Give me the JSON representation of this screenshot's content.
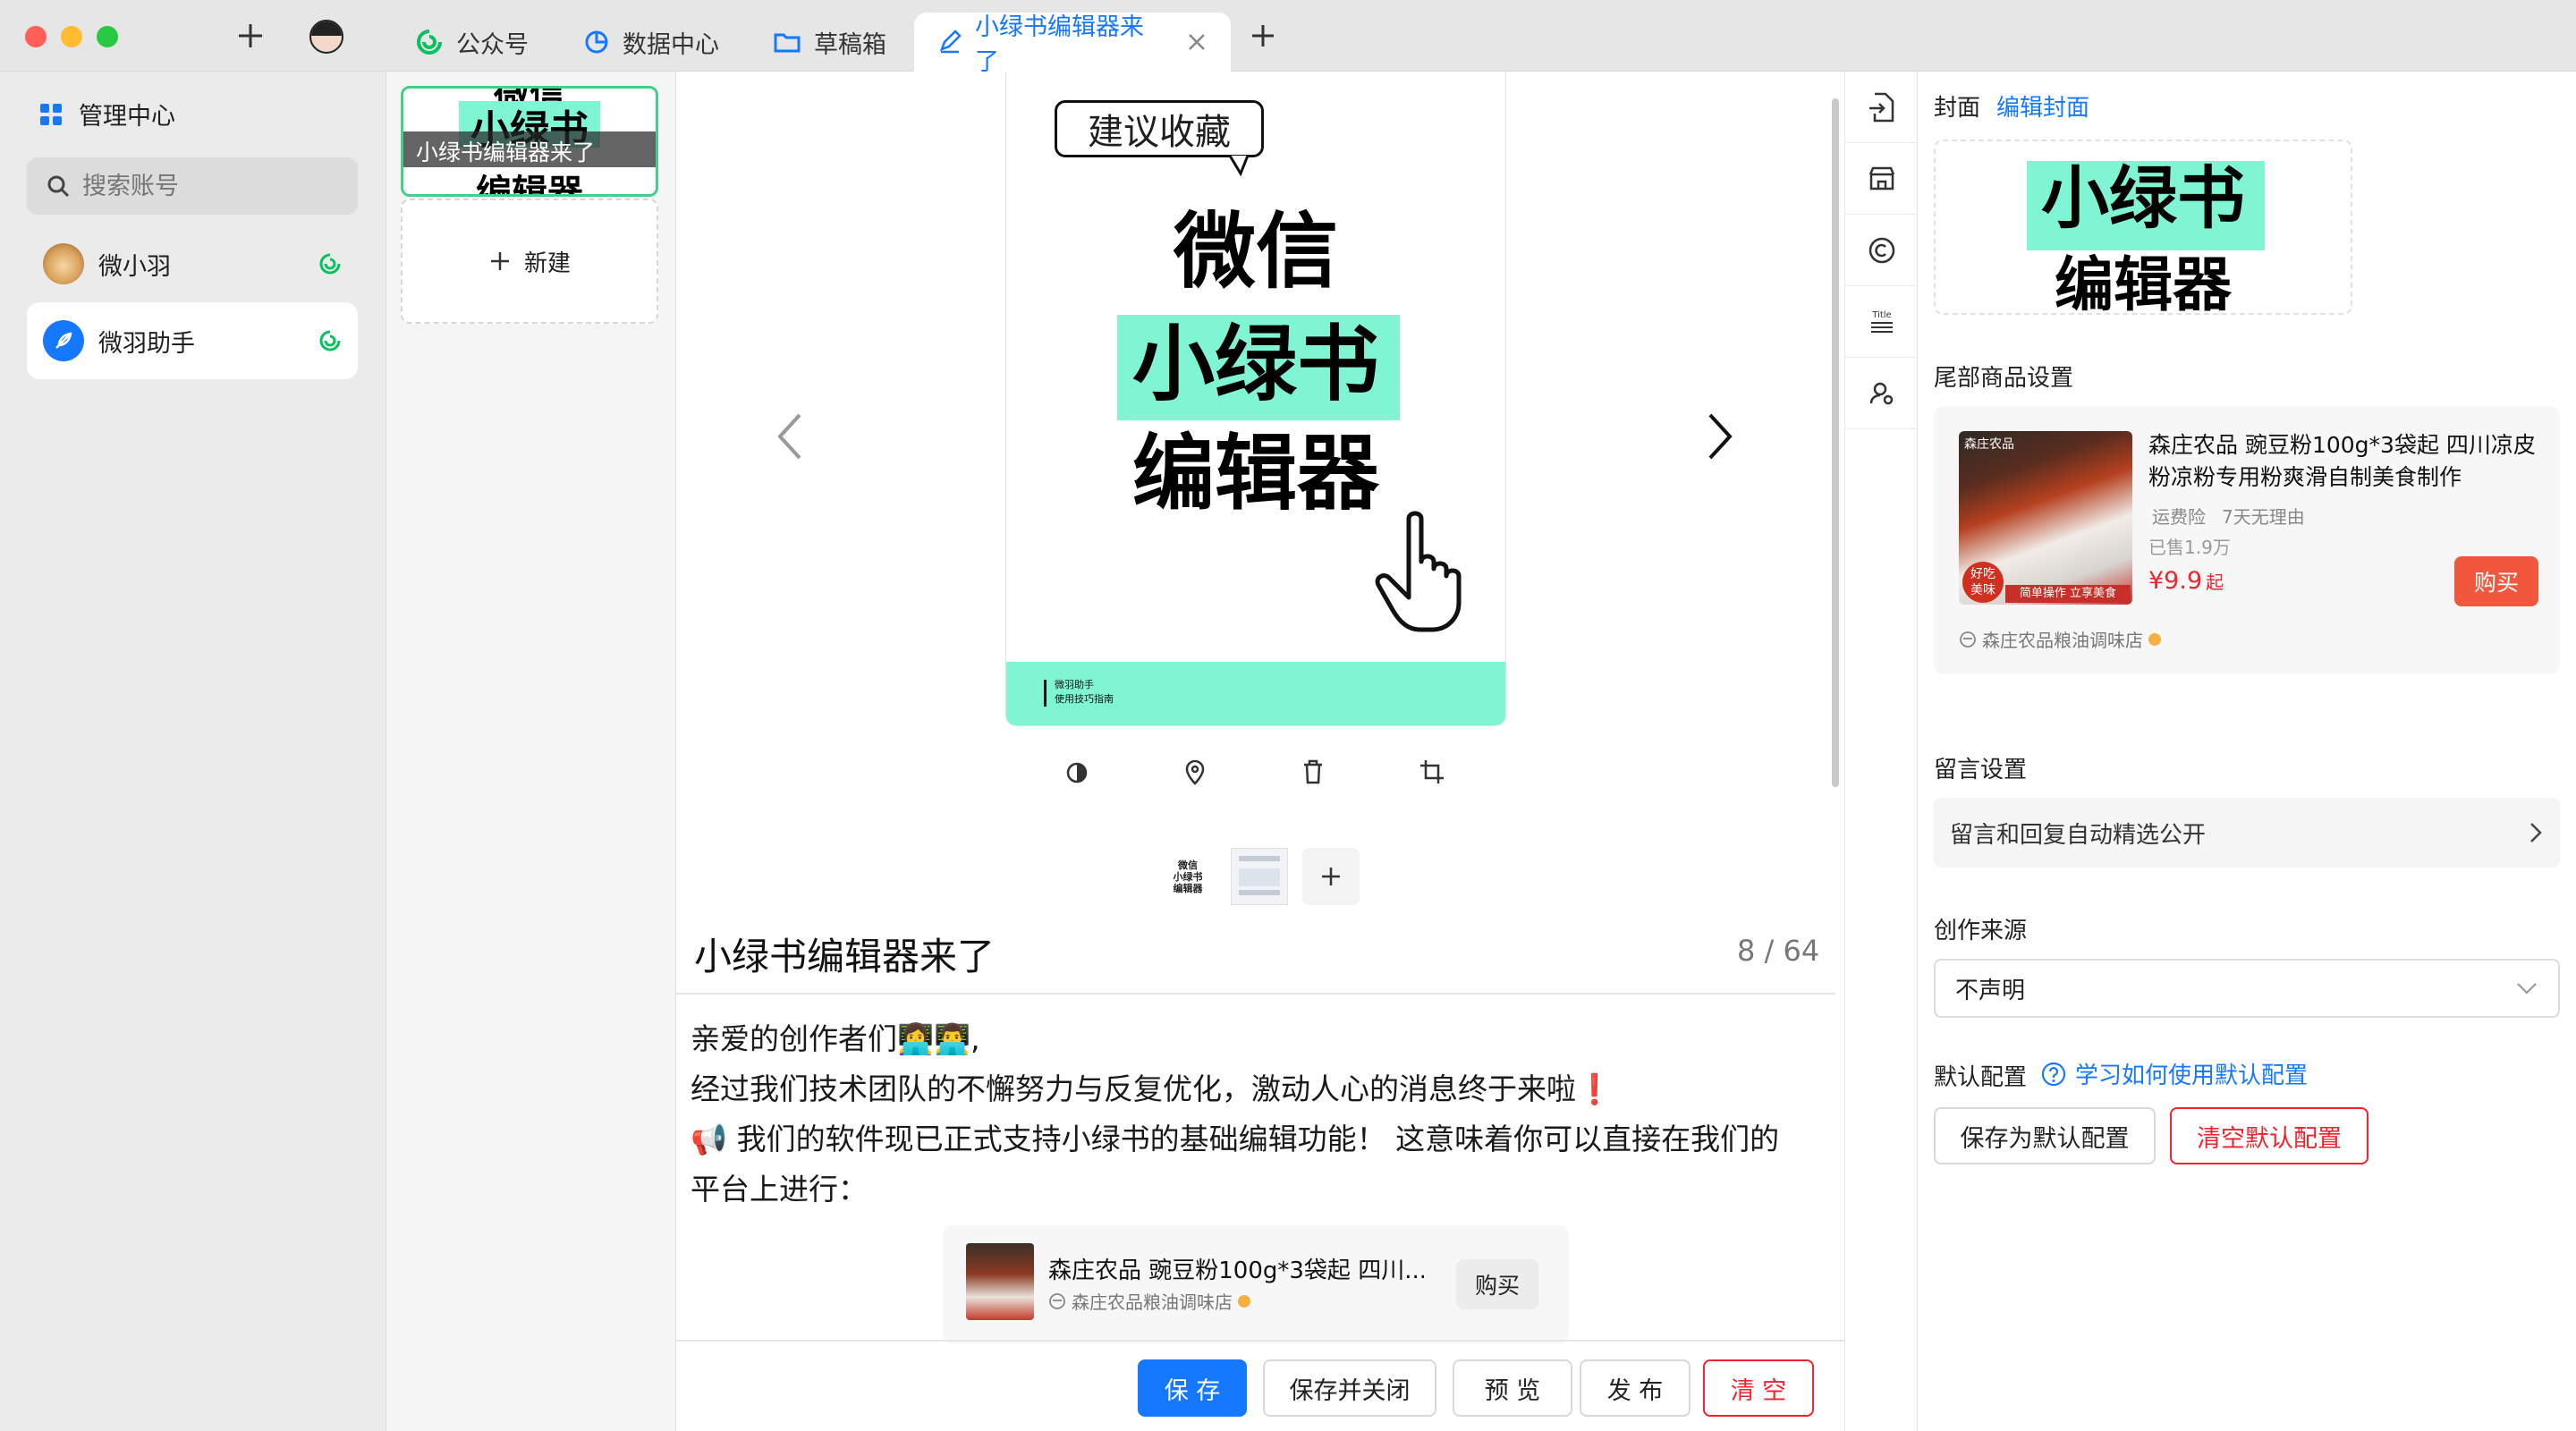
{
  "tabs": [
    {
      "label": "公众号",
      "icon": "wechat-icon"
    },
    {
      "label": "数据中心",
      "icon": "pie-chart-icon"
    },
    {
      "label": "草稿箱",
      "icon": "folder-icon"
    },
    {
      "label": "小绿书编辑器来了",
      "icon": "edit-icon"
    }
  ],
  "sidebar": {
    "title": "管理中心",
    "search_placeholder": "搜索账号",
    "accounts": [
      {
        "name": "微小羽"
      },
      {
        "name": "微羽助手"
      }
    ]
  },
  "drafts": {
    "item_title": "小绿书编辑器来了",
    "new_label": "新建"
  },
  "cover": {
    "bubble": "建议收藏",
    "line1": "微信",
    "line2": "小绿书",
    "line3": "编辑器",
    "footer_line1": "微羽助手",
    "footer_line2": "使用技巧指南"
  },
  "thumb_text": "微信\n小绿书\n编辑器",
  "article": {
    "title": "小绿书编辑器来了",
    "count": "8 / 64",
    "p1": "亲爱的创作者们👩‍💻👨‍💻,",
    "p2": "经过我们技术团队的不懈努力与反复优化，激动人心的消息终于来啦❗",
    "p3": "📢 我们的软件现已正式支持小绿书的基础编辑功能！ 这意味着你可以直接在我们的",
    "p4": "平台上进行："
  },
  "product_card": {
    "name": "森庄农品 豌豆粉100g*3袋起 四川...",
    "shop": "森庄农品粮油调味店",
    "buy": "购买"
  },
  "actions": {
    "save": "保 存",
    "save_close": "保存并关闭",
    "preview": "预 览",
    "publish": "发 布",
    "clear": "清 空"
  },
  "settings": {
    "cover_label": "封面",
    "edit_cover": "编辑封面",
    "cover_line1": "小绿书",
    "cover_line2": "编辑器",
    "tail_label": "尾部商品设置",
    "product": {
      "name": "森庄农品 豌豆粉100g*3袋起 四川凉皮粉凉粉专用粉爽滑自制美食制作",
      "tag1": "运费险",
      "tag2": "7天无理由",
      "sold": "已售1.9万",
      "price": "¥9.9",
      "price_suffix": "起",
      "buy": "购买",
      "shop": "森庄农品粮油调味店",
      "img_brand": "森庄农品",
      "img_badge": "好吃\n美味",
      "img_slogan": "简单操作 立享美食"
    },
    "comment_label": "留言设置",
    "comment_value": "留言和回复自动精选公开",
    "source_label": "创作来源",
    "source_value": "不声明",
    "default_label": "默认配置",
    "default_help": "学习如何使用默认配置",
    "save_default": "保存为默认配置",
    "clear_default": "清空默认配置"
  },
  "colors": {
    "accent": "#1677ff",
    "mint": "#7ff5d3",
    "danger": "#f5222d",
    "wechat_green": "#07c160"
  }
}
